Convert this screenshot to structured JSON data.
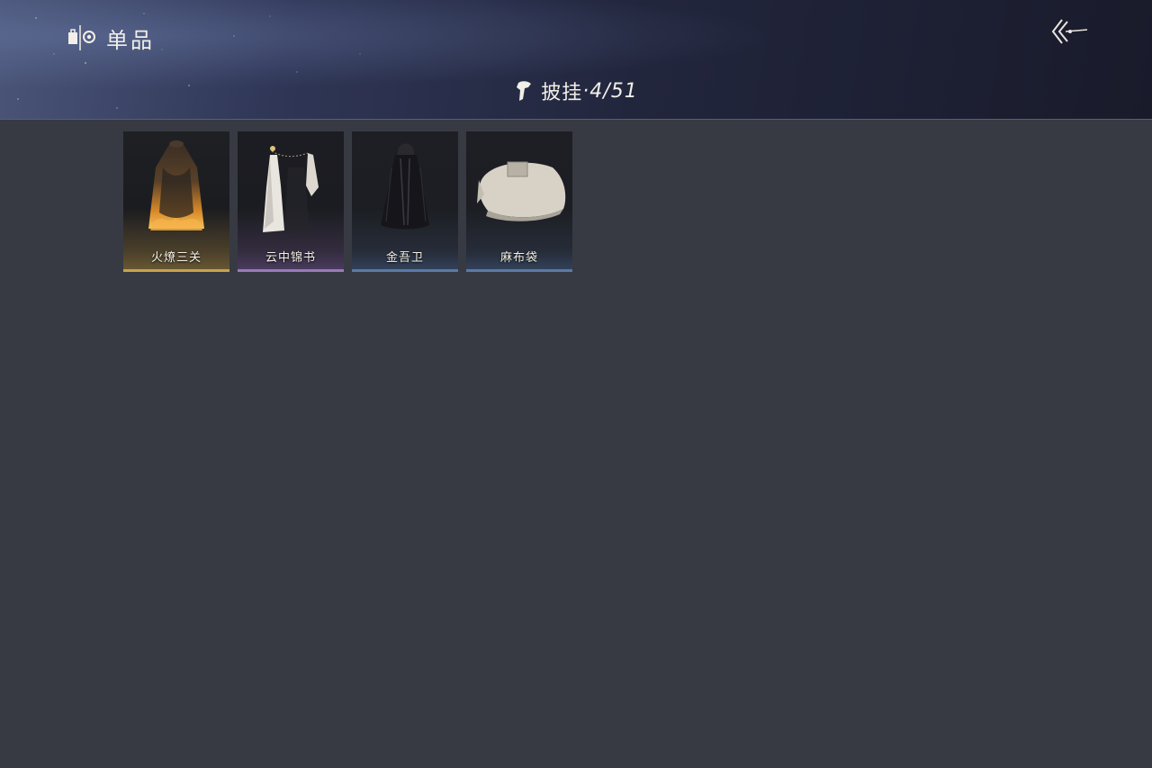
{
  "header": {
    "title": "单品",
    "back_label": "",
    "category": {
      "name": "披挂",
      "count": "·4/51"
    }
  },
  "items": [
    {
      "label": "火燎三关",
      "rarity_color": "#c9a24a"
    },
    {
      "label": "云中锦书",
      "rarity_color": "#9a7ab8"
    },
    {
      "label": "金吾卫",
      "rarity_color": "#5a7aa6"
    },
    {
      "label": "麻布袋",
      "rarity_color": "#5a7aa6"
    }
  ],
  "colors": {
    "background": "#373a42",
    "header_dark": "#191b2b",
    "header_light": "#4a5578"
  }
}
